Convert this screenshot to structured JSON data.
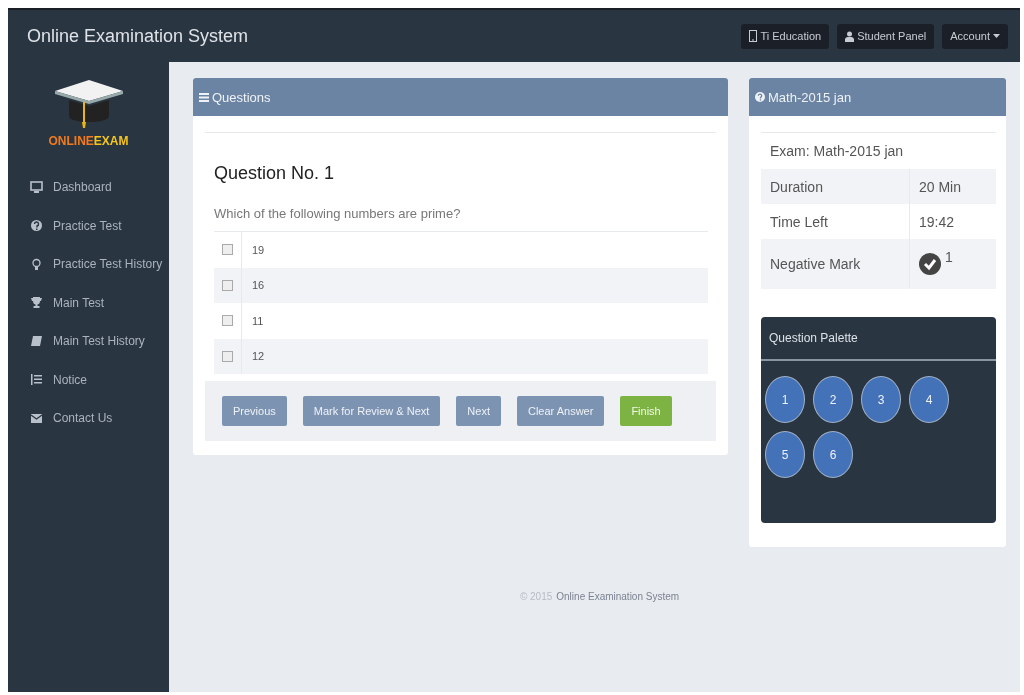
{
  "header": {
    "title": "Online Examination System",
    "buttons": [
      {
        "label": "Ti Education",
        "kind": "tablet"
      },
      {
        "label": "Student Panel",
        "kind": "user"
      },
      {
        "label": "Account",
        "kind": "dropdown"
      }
    ]
  },
  "sidebar": {
    "logo": {
      "part_1": "ONLINE",
      "part_2": "EXAM"
    },
    "items": [
      {
        "label": "Dashboard",
        "kind": "monitor"
      },
      {
        "label": "Practice Test",
        "kind": "question"
      },
      {
        "label": "Practice Test History",
        "kind": "bulb"
      },
      {
        "label": "Main Test",
        "kind": "trophy"
      },
      {
        "label": "Main Test History",
        "kind": "book"
      },
      {
        "label": "Notice",
        "kind": "list"
      },
      {
        "label": "Contact Us",
        "kind": "mail"
      }
    ]
  },
  "questions_panel": {
    "title": "Questions",
    "question_number": "Question No. 1",
    "question": "Which of the following numbers are prime?",
    "options": [
      {
        "label": "19",
        "checked": false
      },
      {
        "label": "16",
        "checked": false
      },
      {
        "label": "11",
        "checked": false
      },
      {
        "label": "12",
        "checked": false
      }
    ],
    "buttons": [
      {
        "label": "Previous",
        "kind": "normal"
      },
      {
        "label": "Mark for Review & Next",
        "kind": "normal"
      },
      {
        "label": "Next",
        "kind": "normal"
      },
      {
        "label": "Clear Answer",
        "kind": "normal"
      },
      {
        "label": "Finish",
        "kind": "success"
      }
    ]
  },
  "exam_panel": {
    "title": "Math-2015 jan",
    "exam": "Exam: Math-2015 jan",
    "rows": [
      {
        "label": "Duration",
        "value": "20 Min"
      },
      {
        "label": "Time Left",
        "value": "19:42"
      },
      {
        "label": "Negative Mark",
        "value": "1",
        "kind": "check"
      }
    ],
    "palette": {
      "title": "Question Palette",
      "questions": [
        "1",
        "2",
        "3",
        "4",
        "5",
        "6"
      ]
    }
  },
  "footer": {
    "copyright": "© 2015",
    "name": "Online Examination System"
  }
}
